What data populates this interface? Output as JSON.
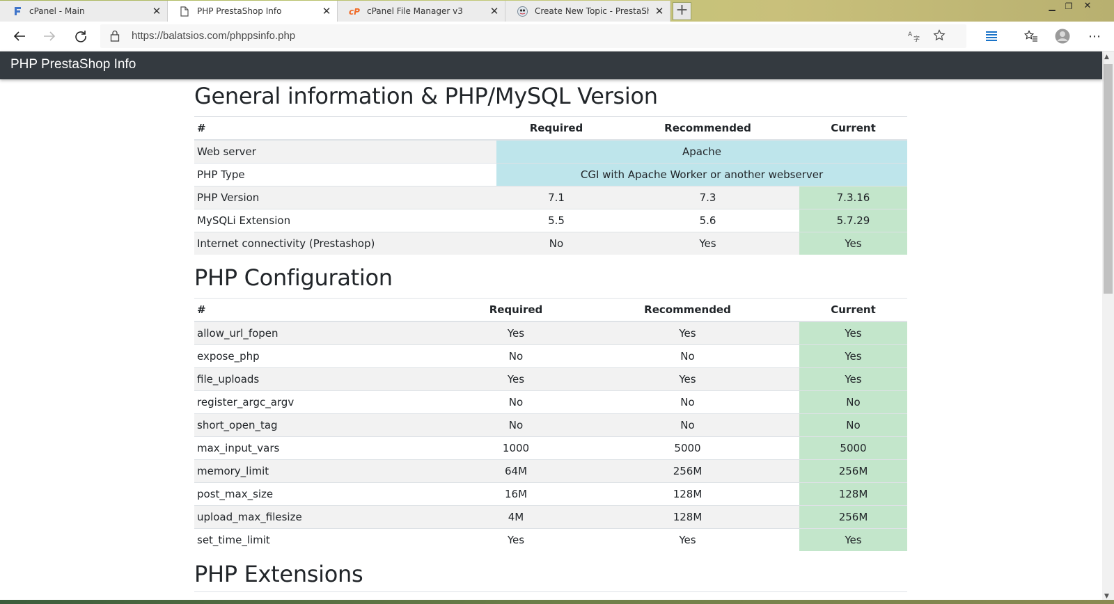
{
  "browser": {
    "tabs": [
      {
        "title": "cPanel - Main",
        "icon": "cpanel-f-icon"
      },
      {
        "title": "PHP PrestaShop Info",
        "icon": "page-icon",
        "active": true
      },
      {
        "title": "cPanel File Manager v3",
        "icon": "cpanel-cp-icon"
      },
      {
        "title": "Create New Topic - PrestaShop F",
        "icon": "prestashop-icon"
      }
    ],
    "new_tab_label": "+",
    "url": "https://balatsios.com/phppsinfo.php"
  },
  "navbar": {
    "brand": "PHP PrestaShop Info"
  },
  "general": {
    "title": "General information & PHP/MySQL Version",
    "headers": [
      "#",
      "Required",
      "Recommended",
      "Current"
    ],
    "rows": [
      {
        "name": "Web server",
        "merged": "Apache"
      },
      {
        "name": "PHP Type",
        "merged": "CGI with Apache Worker or another webserver"
      },
      {
        "name": "PHP Version",
        "required": "7.1",
        "recommended": "7.3",
        "current": "7.3.16"
      },
      {
        "name": "MySQLi Extension",
        "required": "5.5",
        "recommended": "5.6",
        "current": "5.7.29"
      },
      {
        "name": "Internet connectivity (Prestashop)",
        "required": "No",
        "recommended": "Yes",
        "current": "Yes"
      }
    ]
  },
  "php_config": {
    "title": "PHP Configuration",
    "headers": [
      "#",
      "Required",
      "Recommended",
      "Current"
    ],
    "rows": [
      {
        "name": "allow_url_fopen",
        "required": "Yes",
        "recommended": "Yes",
        "current": "Yes"
      },
      {
        "name": "expose_php",
        "required": "No",
        "recommended": "No",
        "current": "Yes"
      },
      {
        "name": "file_uploads",
        "required": "Yes",
        "recommended": "Yes",
        "current": "Yes"
      },
      {
        "name": "register_argc_argv",
        "required": "No",
        "recommended": "No",
        "current": "No"
      },
      {
        "name": "short_open_tag",
        "required": "No",
        "recommended": "No",
        "current": "No"
      },
      {
        "name": "max_input_vars",
        "required": "1000",
        "recommended": "5000",
        "current": "5000"
      },
      {
        "name": "memory_limit",
        "required": "64M",
        "recommended": "256M",
        "current": "256M"
      },
      {
        "name": "post_max_size",
        "required": "16M",
        "recommended": "128M",
        "current": "128M"
      },
      {
        "name": "upload_max_filesize",
        "required": "4M",
        "recommended": "128M",
        "current": "256M"
      },
      {
        "name": "set_time_limit",
        "required": "Yes",
        "recommended": "Yes",
        "current": "Yes"
      }
    ]
  },
  "php_extensions": {
    "title": "PHP Extensions"
  },
  "colors": {
    "navbar": "#343a40",
    "info_cell": "#bee5eb",
    "success_cell": "#c3e6cb"
  }
}
